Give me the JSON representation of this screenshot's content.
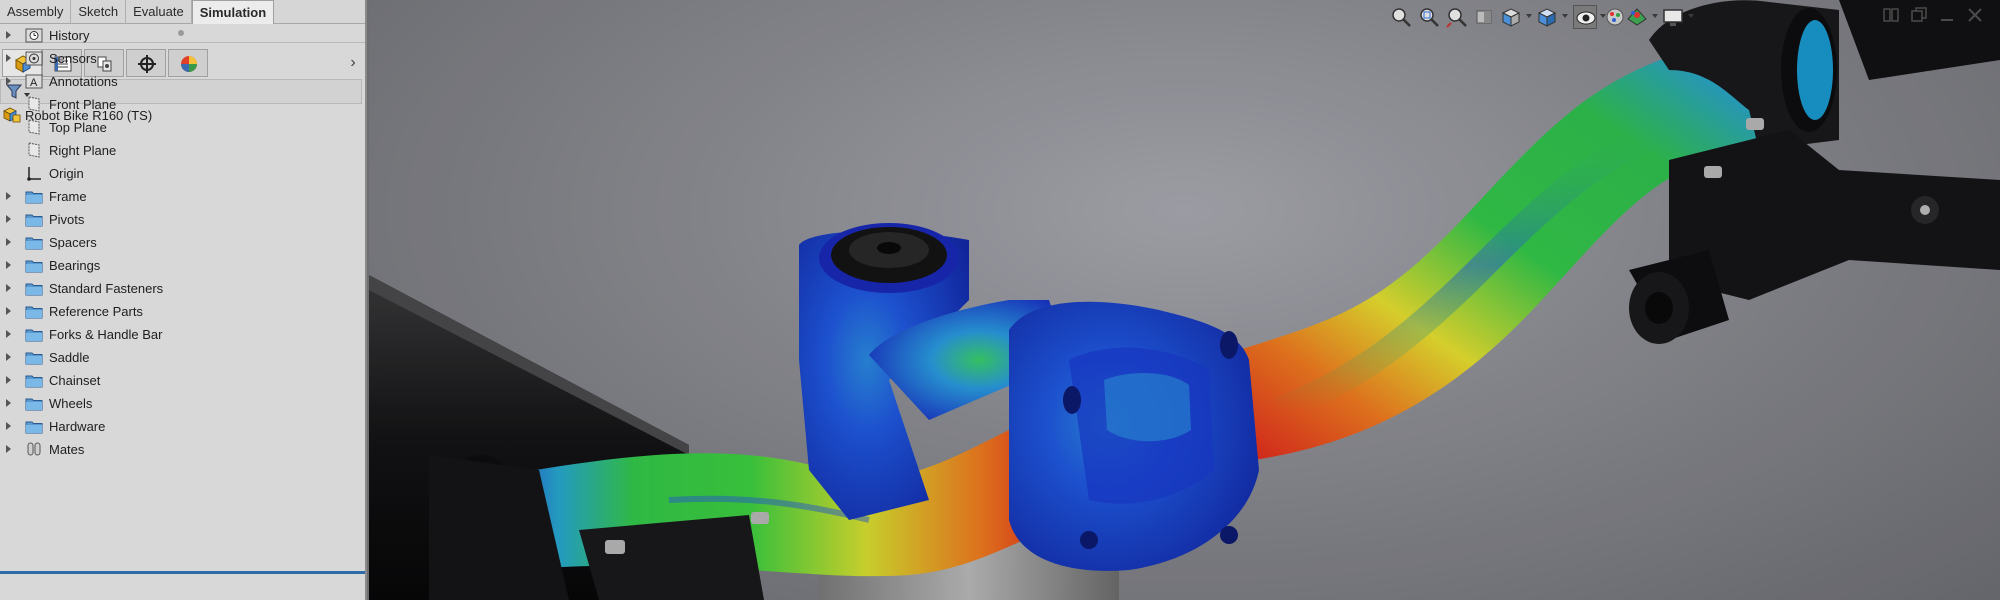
{
  "command_tabs": [
    {
      "label": "Assembly",
      "active": false
    },
    {
      "label": "Sketch",
      "active": false
    },
    {
      "label": "Evaluate",
      "active": false
    },
    {
      "label": "Simulation",
      "active": true
    }
  ],
  "manager_tabs": [
    {
      "icon": "featuremanager-icon",
      "active": true
    },
    {
      "icon": "propertymanager-icon",
      "active": false
    },
    {
      "icon": "configurationmanager-icon",
      "active": false
    },
    {
      "icon": "dimxpertmanager-icon",
      "active": false
    },
    {
      "icon": "displaymanager-icon",
      "active": false
    }
  ],
  "filter": {
    "icon": "filter-icon"
  },
  "tree": {
    "root": {
      "label": "Robot Bike R160  (TS)",
      "icon": "assembly-icon"
    },
    "items": [
      {
        "label": "History",
        "icon": "history-icon",
        "expandable": true
      },
      {
        "label": "Sensors",
        "icon": "sensors-icon",
        "expandable": true
      },
      {
        "label": "Annotations",
        "icon": "annotations-icon",
        "expandable": true
      },
      {
        "label": "Front Plane",
        "icon": "plane-icon",
        "expandable": false
      },
      {
        "label": "Top Plane",
        "icon": "plane-icon",
        "expandable": false
      },
      {
        "label": "Right Plane",
        "icon": "plane-icon",
        "expandable": false
      },
      {
        "label": "Origin",
        "icon": "origin-icon",
        "expandable": false
      },
      {
        "label": "Frame",
        "icon": "folder-icon",
        "expandable": true
      },
      {
        "label": "Pivots",
        "icon": "folder-icon",
        "expandable": true
      },
      {
        "label": "Spacers",
        "icon": "folder-icon",
        "expandable": true
      },
      {
        "label": "Bearings",
        "icon": "folder-icon",
        "expandable": true
      },
      {
        "label": "Standard Fasteners",
        "icon": "folder-icon",
        "expandable": true
      },
      {
        "label": "Reference Parts",
        "icon": "folder-icon",
        "expandable": true
      },
      {
        "label": "Forks  & Handle Bar",
        "icon": "folder-icon",
        "expandable": true
      },
      {
        "label": "Saddle",
        "icon": "folder-icon",
        "expandable": true
      },
      {
        "label": "Chainset",
        "icon": "folder-icon",
        "expandable": true
      },
      {
        "label": "Wheels",
        "icon": "folder-icon",
        "expandable": true
      },
      {
        "label": "Hardware",
        "icon": "folder-icon",
        "expandable": true
      },
      {
        "label": "Mates",
        "icon": "mates-icon",
        "expandable": true
      }
    ]
  },
  "hud_toolbar": [
    {
      "icon": "zoom-to-fit-icon",
      "active": false,
      "caret": false
    },
    {
      "icon": "zoom-to-area-icon",
      "active": false,
      "caret": false
    },
    {
      "icon": "previous-view-icon",
      "active": false,
      "caret": false
    },
    {
      "icon": "section-view-icon",
      "active": false,
      "caret": false
    },
    {
      "icon": "view-orientation-icon",
      "active": false,
      "caret": true
    },
    {
      "icon": "display-style-icon",
      "active": false,
      "caret": true
    },
    {
      "icon": "hide-show-items-icon",
      "active": true,
      "caret": true
    },
    {
      "icon": "edit-appearance-icon",
      "active": false,
      "caret": false
    },
    {
      "icon": "apply-scene-icon",
      "active": false,
      "caret": true
    },
    {
      "icon": "view-settings-icon",
      "active": false,
      "caret": true
    }
  ],
  "window_controls": [
    "tile-icon",
    "restore-icon",
    "minimize-icon",
    "close-icon"
  ],
  "colors": {
    "pane_bg": "#d8d8d8",
    "accent_blue": "#2f6da8",
    "stress_low": "#1f3fd0",
    "stress_mid": "#34c84a",
    "stress_high": "#e01e1e"
  },
  "viewport": {
    "content": "stress-contour-plot-of-bike-stem-and-handlebar"
  }
}
